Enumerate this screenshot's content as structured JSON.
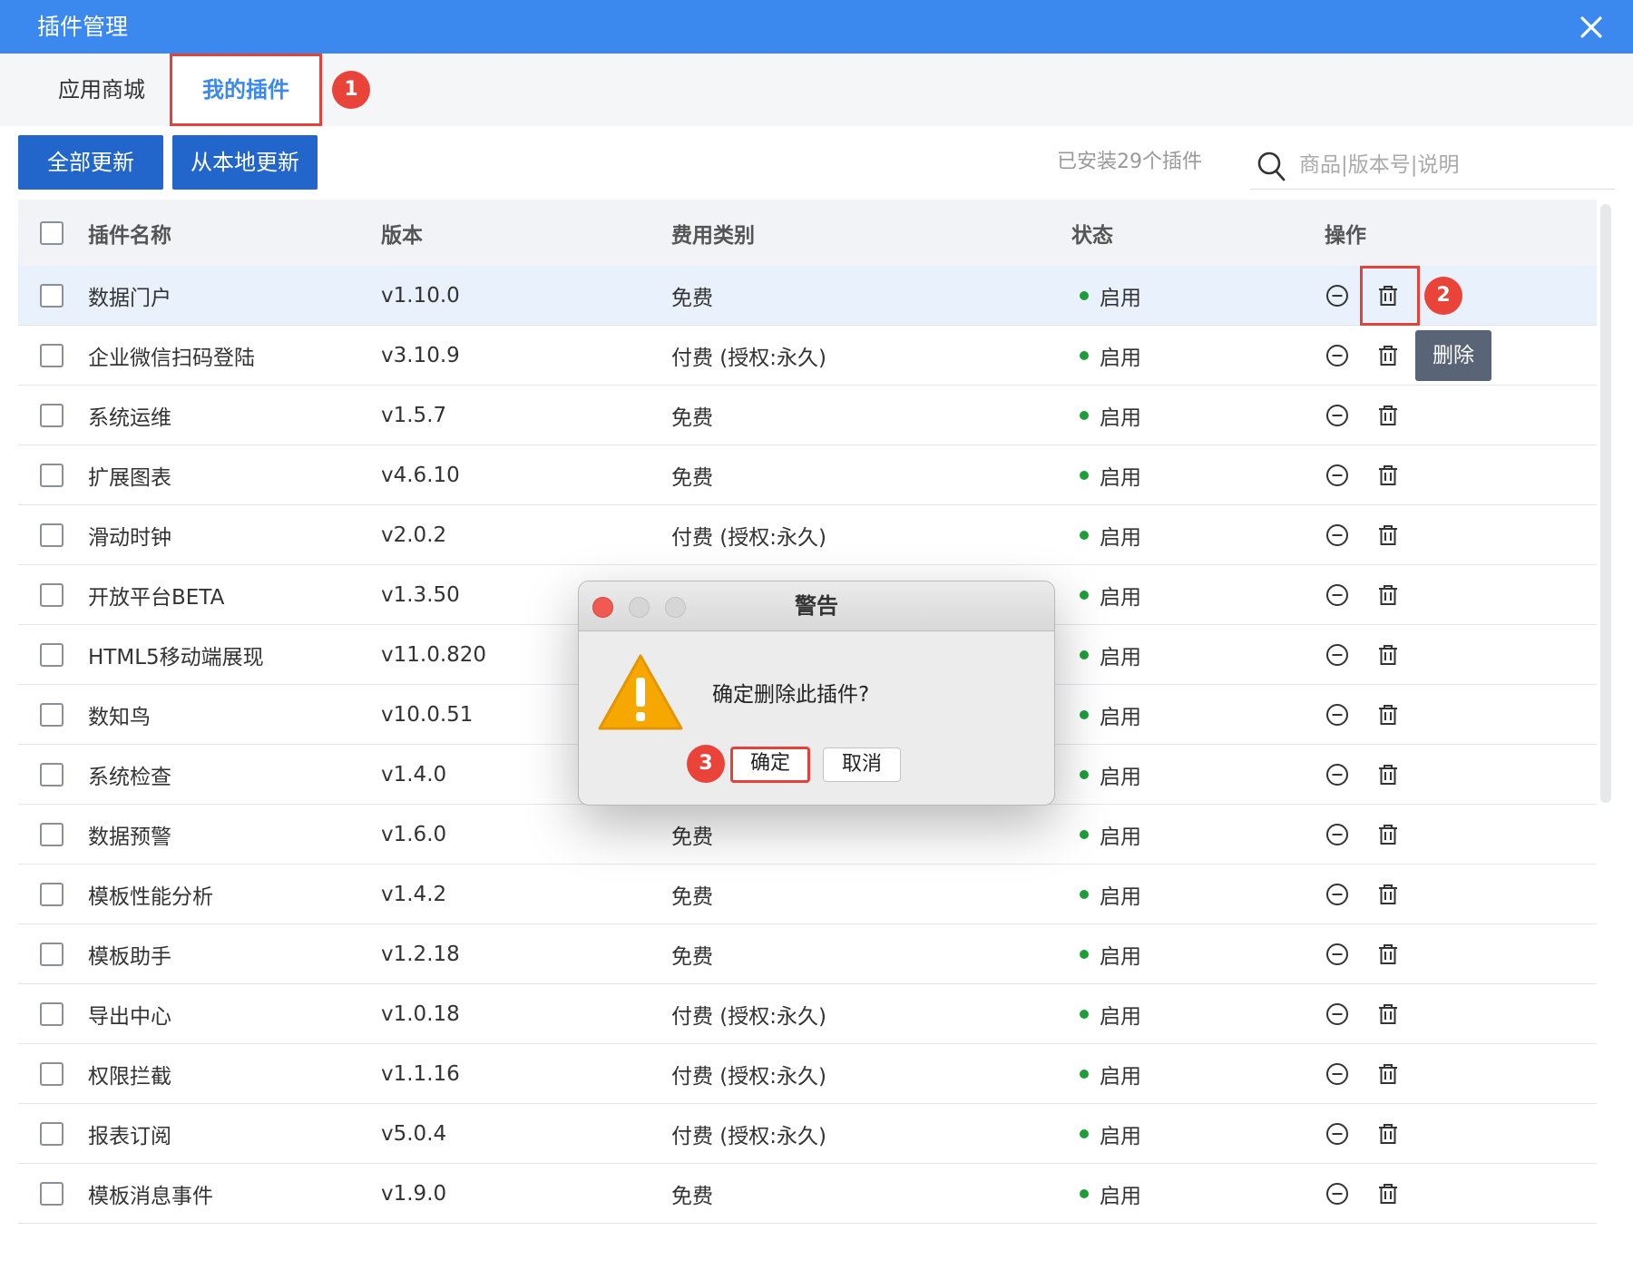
{
  "window": {
    "title": "插件管理"
  },
  "tabs": [
    {
      "label": "应用商城",
      "active": false
    },
    {
      "label": "我的插件",
      "active": true
    }
  ],
  "badges": {
    "step1": "1",
    "step2": "2",
    "step3": "3"
  },
  "toolbar": {
    "update_all_label": "全部更新",
    "update_local_label": "从本地更新",
    "installed_count": "已安装29个插件",
    "search_placeholder": "商品|版本号|说明"
  },
  "table": {
    "headers": {
      "name": "插件名称",
      "version": "版本",
      "fee": "费用类别",
      "status": "状态",
      "actions": "操作"
    },
    "rows": [
      {
        "name": "数据门户",
        "version": "v1.10.0",
        "fee": "免费",
        "status": "启用"
      },
      {
        "name": " 企业微信扫码登陆",
        "version": "v3.10.9",
        "fee": "付费 (授权:永久)",
        "status": "启用"
      },
      {
        "name": "系统运维",
        "version": "v1.5.7",
        "fee": "免费",
        "status": "启用"
      },
      {
        "name": "扩展图表",
        "version": "v4.6.10",
        "fee": "免费",
        "status": "启用"
      },
      {
        "name": "滑动时钟",
        "version": "v2.0.2",
        "fee": "付费 (授权:永久)",
        "status": "启用"
      },
      {
        "name": " 开放平台BETA",
        "version": "v1.3.50",
        "fee": "",
        "status": "启用"
      },
      {
        "name": "HTML5移动端展现",
        "version": "v11.0.820",
        "fee": "",
        "status": "启用"
      },
      {
        "name": "数知鸟",
        "version": "v10.0.51",
        "fee": "",
        "status": "启用"
      },
      {
        "name": "系统检查",
        "version": "v1.4.0",
        "fee": "",
        "status": "启用"
      },
      {
        "name": "数据预警",
        "version": "v1.6.0",
        "fee": "免费",
        "status": "启用"
      },
      {
        "name": "模板性能分析",
        "version": "v1.4.2",
        "fee": "免费",
        "status": "启用"
      },
      {
        "name": "模板助手",
        "version": "v1.2.18",
        "fee": "免费",
        "status": "启用"
      },
      {
        "name": "导出中心",
        "version": "v1.0.18",
        "fee": "付费 (授权:永久)",
        "status": "启用"
      },
      {
        "name": "权限拦截",
        "version": "v1.1.16",
        "fee": "付费 (授权:永久)",
        "status": "启用"
      },
      {
        "name": "报表订阅",
        "version": "v5.0.4",
        "fee": "付费 (授权:永久)",
        "status": "启用"
      },
      {
        "name": "模板消息事件",
        "version": "v1.9.0",
        "fee": "免费",
        "status": "启用"
      }
    ]
  },
  "tooltip": {
    "delete": "删除"
  },
  "dialog": {
    "title": "警告",
    "message": "确定删除此插件?",
    "ok_label": "确定",
    "cancel_label": "取消"
  },
  "colors": {
    "titlebar": "#3b89ef",
    "primary_button": "#2266cc",
    "annotation_red": "#e9433a",
    "status_green": "#1f9d3a"
  },
  "icons": {
    "close": "close-icon",
    "search": "search-icon",
    "disable": "minus-circle-icon",
    "delete": "trash-icon",
    "warning": "warning-triangle-icon"
  }
}
